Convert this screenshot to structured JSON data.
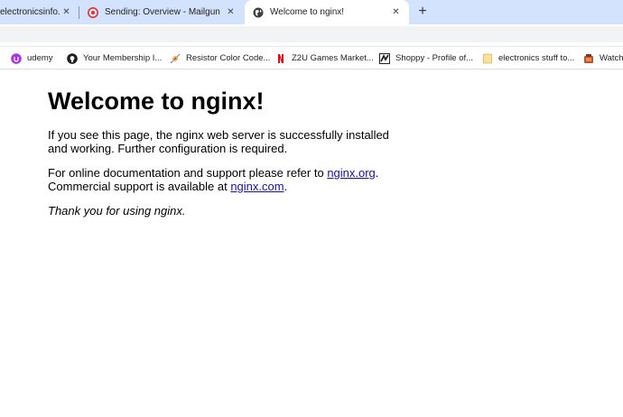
{
  "browser": {
    "tabs": [
      {
        "title": "electronicsinfo.ne",
        "favicon": "page-icon",
        "active": false
      },
      {
        "title": "Sending: Overview - Mailgun",
        "favicon": "mailgun-icon",
        "active": false
      },
      {
        "title": "Welcome to nginx!",
        "favicon": "globe-icon",
        "active": true
      }
    ],
    "new_tab_label": "+",
    "close_glyph": "✕"
  },
  "bookmarks": [
    {
      "label": "udemy",
      "icon": "udemy-icon"
    },
    {
      "label": "Your Membership I...",
      "icon": "github-icon"
    },
    {
      "label": "Resistor Color Code...",
      "icon": "resistor-icon"
    },
    {
      "label": "Z2U Games Market...",
      "icon": "netflix-icon"
    },
    {
      "label": "Shoppy - Profile of...",
      "icon": "shoppy-icon"
    },
    {
      "label": "electronics stuff to...",
      "icon": "folder-icon"
    },
    {
      "label": "Watch",
      "icon": "watch-icon"
    }
  ],
  "page": {
    "heading": "Welcome to nginx!",
    "para1": "If you see this page, the nginx web server is successfully installed and working. Further configuration is required.",
    "para2_prefix": "For online documentation and support please refer to ",
    "link1": "nginx.org",
    "para2_mid": ".",
    "para2_line2_prefix": "Commercial support is available at ",
    "link2": "nginx.com",
    "para2_suffix": ".",
    "thanks": "Thank you for using nginx."
  }
}
